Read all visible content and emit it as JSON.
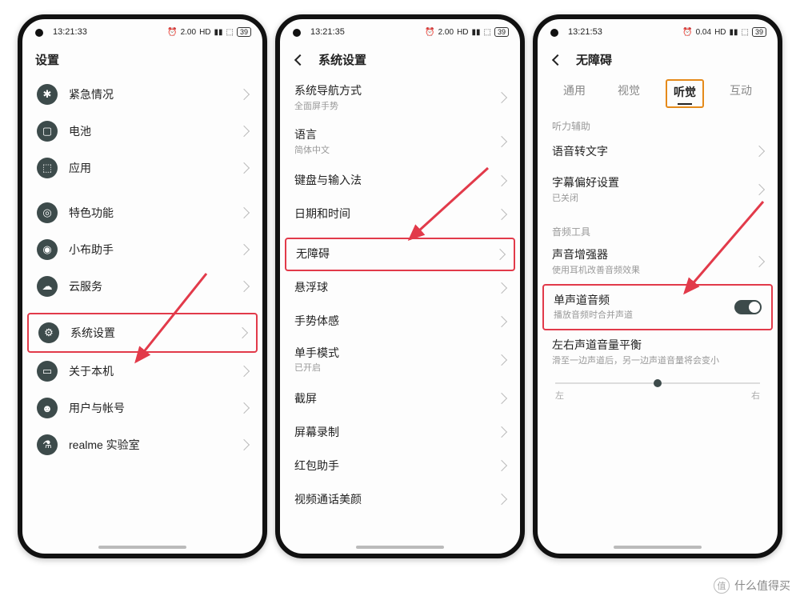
{
  "statusbar": {
    "battery": "39"
  },
  "phone1": {
    "time": "13:21:33",
    "header": "设置",
    "items": [
      {
        "title": "紧急情况",
        "icon": "✱"
      },
      {
        "title": "电池",
        "icon": "▢"
      },
      {
        "title": "应用",
        "icon": "⬚"
      },
      {
        "title": "特色功能",
        "icon": "◎"
      },
      {
        "title": "小布助手",
        "icon": "◉"
      },
      {
        "title": "云服务",
        "icon": "☁"
      },
      {
        "title": "系统设置",
        "icon": "⚙"
      },
      {
        "title": "关于本机",
        "icon": "▭"
      },
      {
        "title": "用户与帐号",
        "icon": "☻"
      },
      {
        "title": "realme 实验室",
        "icon": "⚗"
      }
    ]
  },
  "phone2": {
    "time": "13:21:35",
    "header": "系统设置",
    "items": [
      {
        "title": "系统导航方式",
        "sub": "全面屏手势"
      },
      {
        "title": "语言",
        "sub": "简体中文"
      },
      {
        "title": "键盘与输入法"
      },
      {
        "title": "日期和时间"
      },
      {
        "title": "无障碍"
      },
      {
        "title": "悬浮球"
      },
      {
        "title": "手势体感"
      },
      {
        "title": "单手模式",
        "sub": "已开启"
      },
      {
        "title": "截屏"
      },
      {
        "title": "屏幕录制"
      },
      {
        "title": "红包助手"
      },
      {
        "title": "视频通话美颜"
      }
    ]
  },
  "phone3": {
    "time": "13:21:53",
    "header": "无障碍",
    "tabs": [
      "通用",
      "视觉",
      "听觉",
      "互动"
    ],
    "section1": "听力辅助",
    "voiceToText": "语音转文字",
    "subtitle": {
      "title": "字幕偏好设置",
      "sub": "已关闭"
    },
    "section2": "音频工具",
    "enhancer": {
      "title": "声音增强器",
      "sub": "使用耳机改善音频效果"
    },
    "mono": {
      "title": "单声道音频",
      "sub": "播放音频时合并声道"
    },
    "balance": {
      "title": "左右声道音量平衡",
      "sub": "滑至一边声道后，另一边声道音量将会变小"
    },
    "left": "左",
    "right": "右"
  },
  "watermark": "什么值得买"
}
